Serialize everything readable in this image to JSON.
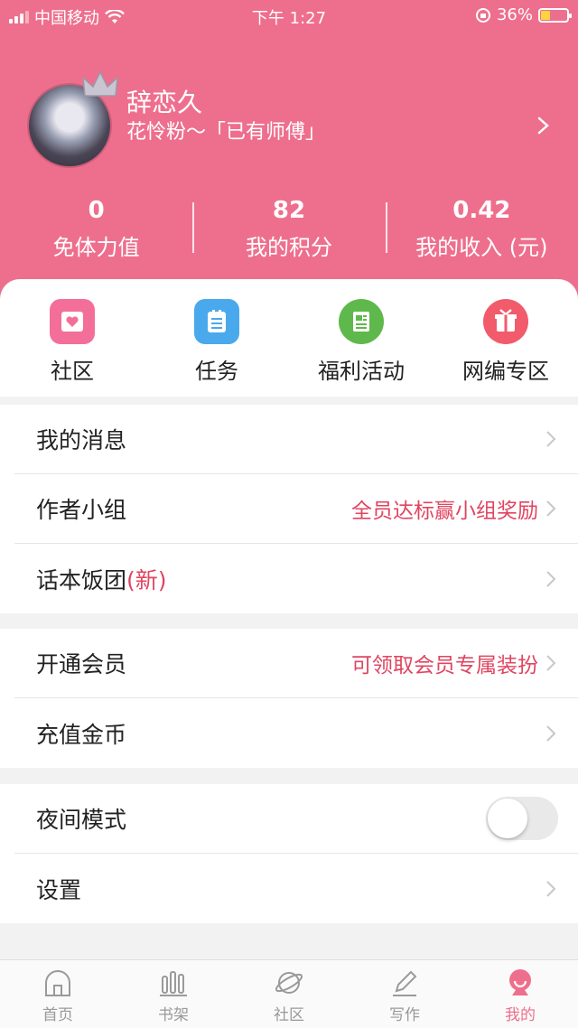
{
  "status_bar": {
    "carrier": "中国移动",
    "time": "下午 1:27",
    "battery": "36%"
  },
  "profile": {
    "name": "辞恋久",
    "tag": "花怜粉～「已有师傅」"
  },
  "stats": [
    {
      "value": "0",
      "label": "免体力值"
    },
    {
      "value": "82",
      "label": "我的积分"
    },
    {
      "value": "0.42",
      "label": "我的收入 (元)"
    }
  ],
  "quick_actions": [
    {
      "label": "社区",
      "icon": "heart-card-icon",
      "color": "#f36f9a"
    },
    {
      "label": "任务",
      "icon": "task-list-icon",
      "color": "#4aa9ec"
    },
    {
      "label": "福利活动",
      "icon": "document-icon",
      "color": "#5fb84b"
    },
    {
      "label": "网编专区",
      "icon": "gift-icon",
      "color": "#f15b6c"
    }
  ],
  "menu_group1": {
    "messages": {
      "title": "我的消息"
    },
    "author_group": {
      "title": "作者小组",
      "extra": "全员达标赢小组奖励"
    },
    "script_group": {
      "title": "话本饭团",
      "badge": "(新)"
    }
  },
  "menu_group2": {
    "vip": {
      "title": "开通会员",
      "extra": "可领取会员专属装扮"
    },
    "recharge": {
      "title": "充值金币"
    }
  },
  "menu_group3": {
    "night_mode": {
      "title": "夜间模式",
      "enabled": false
    },
    "settings": {
      "title": "设置"
    }
  },
  "tabbar": [
    {
      "label": "首页",
      "icon": "home-icon"
    },
    {
      "label": "书架",
      "icon": "bookshelf-icon"
    },
    {
      "label": "社区",
      "icon": "planet-icon"
    },
    {
      "label": "写作",
      "icon": "pencil-icon"
    },
    {
      "label": "我的",
      "icon": "profile-icon",
      "active": true
    }
  ],
  "colors": {
    "brand_pink": "#ee6f8d",
    "accent_red": "#e04561"
  }
}
